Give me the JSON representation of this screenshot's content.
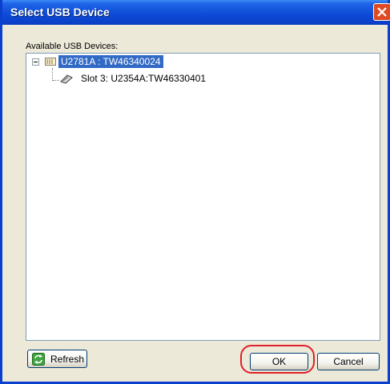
{
  "dialog": {
    "title": "Select USB Device"
  },
  "devices_panel": {
    "label": "Available USB Devices:",
    "tree": [
      {
        "label": "U2781A : TW46340024",
        "selected": true,
        "expanded": true,
        "icon": "chassis-icon",
        "children": [
          {
            "label": "Slot 3: U2354A:TW46330401",
            "icon": "module-icon"
          }
        ]
      }
    ]
  },
  "buttons": {
    "refresh": "Refresh",
    "ok": "OK",
    "cancel": "Cancel"
  },
  "colors": {
    "titlebar": "#0a3dc4",
    "selection": "#316ac5",
    "highlight_ring": "#e0202a"
  }
}
